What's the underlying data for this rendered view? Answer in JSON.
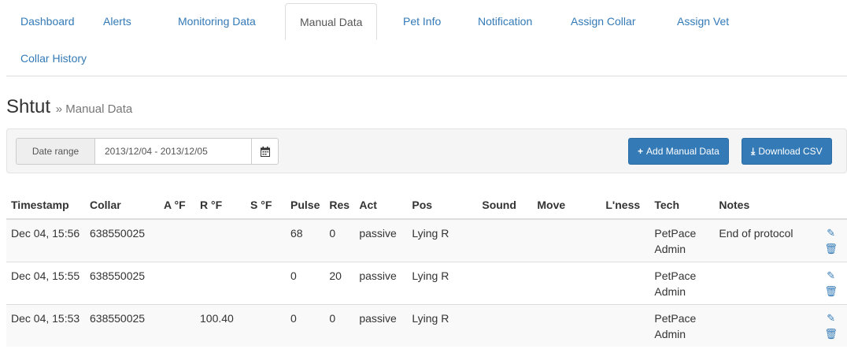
{
  "nav": {
    "tabs": [
      {
        "label": "Dashboard"
      },
      {
        "label": "Alerts"
      },
      {
        "label": "Monitoring Data"
      },
      {
        "label": "Manual Data"
      },
      {
        "label": "Pet Info"
      },
      {
        "label": "Notification"
      },
      {
        "label": "Assign Collar"
      },
      {
        "label": "Assign Vet"
      },
      {
        "label": "Collar History"
      }
    ],
    "active": "Manual Data"
  },
  "header": {
    "pet_name": "Shtut",
    "section": "» Manual Data"
  },
  "toolbar": {
    "date_range_label": "Date range",
    "date_range_value": "2013/12/04 - 2013/12/05",
    "add_label": "Add Manual Data",
    "download_label": "Download CSV",
    "accent_color": "#337ab7"
  },
  "table": {
    "columns": [
      "Timestamp",
      "Collar",
      "A °F",
      "R °F",
      "S °F",
      "Pulse",
      "Res",
      "Act",
      "Pos",
      "Sound",
      "Move",
      "L'ness",
      "Tech",
      "Notes",
      ""
    ],
    "rows": [
      {
        "timestamp": "Dec 04, 15:56",
        "collar": "638550025",
        "a": "",
        "r": "",
        "s": "",
        "pulse": "68",
        "res": "0",
        "act": "passive",
        "pos": "Lying R",
        "sound": "",
        "move": "",
        "lness": "",
        "tech": "PetPace Admin",
        "notes": "End of protocol"
      },
      {
        "timestamp": "Dec 04, 15:55",
        "collar": "638550025",
        "a": "",
        "r": "",
        "s": "",
        "pulse": "0",
        "res": "20",
        "act": "passive",
        "pos": "Lying R",
        "sound": "",
        "move": "",
        "lness": "",
        "tech": "PetPace Admin",
        "notes": ""
      },
      {
        "timestamp": "Dec 04, 15:53",
        "collar": "638550025",
        "a": "",
        "r": "100.40",
        "s": "",
        "pulse": "0",
        "res": "0",
        "act": "passive",
        "pos": "Lying R",
        "sound": "",
        "move": "",
        "lness": "",
        "tech": "PetPace Admin",
        "notes": ""
      }
    ],
    "icons": [
      "edit-icon",
      "trash-icon"
    ]
  }
}
